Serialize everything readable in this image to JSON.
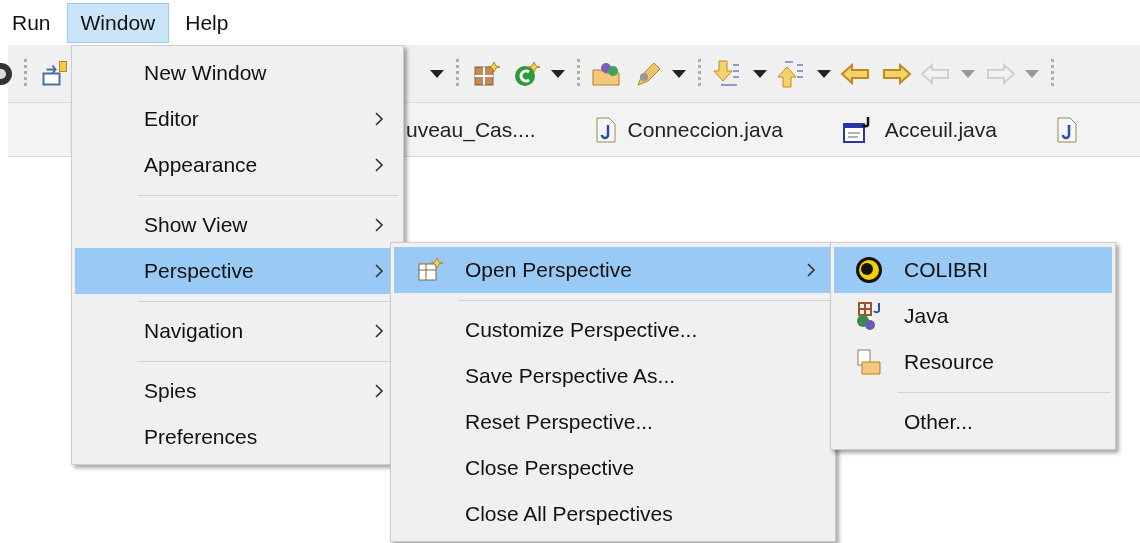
{
  "menubar": [
    {
      "label": "Run",
      "selected": false
    },
    {
      "label": "Window",
      "selected": true
    },
    {
      "label": "Help",
      "selected": false
    }
  ],
  "toolbar": {
    "left": [
      {
        "kind": "button",
        "disabled": false
      },
      {
        "kind": "separator"
      },
      {
        "kind": "button",
        "disabled": false
      }
    ],
    "right": [
      {
        "kind": "dropdown",
        "disabled": false
      },
      {
        "kind": "separator"
      },
      {
        "kind": "button",
        "disabled": false
      },
      {
        "kind": "button",
        "disabled": false
      },
      {
        "kind": "dropdown",
        "disabled": false
      },
      {
        "kind": "separator"
      },
      {
        "kind": "button",
        "disabled": false
      },
      {
        "kind": "button",
        "disabled": false
      },
      {
        "kind": "dropdown",
        "disabled": false
      },
      {
        "kind": "separator"
      },
      {
        "kind": "button",
        "disabled": false
      },
      {
        "kind": "dropdown",
        "disabled": false
      },
      {
        "kind": "button",
        "disabled": false
      },
      {
        "kind": "dropdown",
        "disabled": false
      },
      {
        "kind": "button",
        "disabled": false
      },
      {
        "kind": "button",
        "disabled": false
      },
      {
        "kind": "button",
        "disabled": true
      },
      {
        "kind": "dropdown",
        "disabled": true
      },
      {
        "kind": "button",
        "disabled": true
      },
      {
        "kind": "dropdown",
        "disabled": true
      },
      {
        "kind": "separator"
      }
    ]
  },
  "editor_tabs": [
    {
      "label": "uveau_Cas...."
    },
    {
      "label": "Conneccion.java"
    },
    {
      "label": "Acceuil.java"
    }
  ],
  "window_menu": [
    {
      "kind": "item",
      "label": "New Window",
      "submenu": false,
      "selected": false
    },
    {
      "kind": "item",
      "label": "Editor",
      "submenu": true,
      "selected": false
    },
    {
      "kind": "item",
      "label": "Appearance",
      "submenu": true,
      "selected": false
    },
    {
      "kind": "separator"
    },
    {
      "kind": "item",
      "label": "Show View",
      "submenu": true,
      "selected": false
    },
    {
      "kind": "item",
      "label": "Perspective",
      "submenu": true,
      "selected": true
    },
    {
      "kind": "separator"
    },
    {
      "kind": "item",
      "label": "Navigation",
      "submenu": true,
      "selected": false
    },
    {
      "kind": "separator"
    },
    {
      "kind": "item",
      "label": "Spies",
      "submenu": true,
      "selected": false
    },
    {
      "kind": "item",
      "label": "Preferences",
      "submenu": false,
      "selected": false
    }
  ],
  "perspective_menu": [
    {
      "kind": "item",
      "label": "Open Perspective",
      "submenu": true,
      "selected": true
    },
    {
      "kind": "separator"
    },
    {
      "kind": "item",
      "label": "Customize Perspective...",
      "submenu": false,
      "selected": false
    },
    {
      "kind": "item",
      "label": "Save Perspective As...",
      "submenu": false,
      "selected": false
    },
    {
      "kind": "item",
      "label": "Reset Perspective...",
      "submenu": false,
      "selected": false
    },
    {
      "kind": "item",
      "label": "Close Perspective",
      "submenu": false,
      "selected": false
    },
    {
      "kind": "item",
      "label": "Close All Perspectives",
      "submenu": false,
      "selected": false
    }
  ],
  "open_perspective_menu": [
    {
      "kind": "item",
      "label": "COLIBRI",
      "submenu": false,
      "selected": true
    },
    {
      "kind": "item",
      "label": "Java",
      "submenu": false,
      "selected": false
    },
    {
      "kind": "item",
      "label": "Resource",
      "submenu": false,
      "selected": false
    },
    {
      "kind": "separator"
    },
    {
      "kind": "item",
      "label": "Other...",
      "submenu": false,
      "selected": false
    }
  ]
}
